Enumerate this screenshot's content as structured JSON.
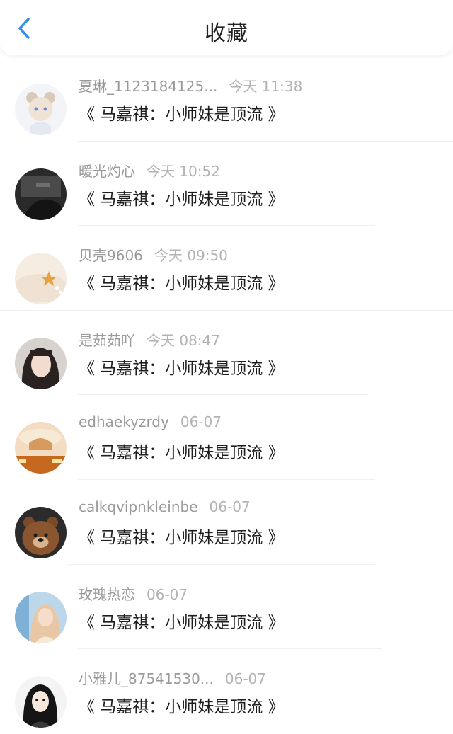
{
  "header": {
    "title": "收藏",
    "back_icon": "chevron-left-icon",
    "accent_color": "#2f8fe8"
  },
  "favorites": [
    {
      "user": "夏琳_1123184125...",
      "time": "今天 11:38",
      "book": "《 马嘉祺：小师妹是顶流 》"
    },
    {
      "user": "暖光灼心",
      "time": "今天 10:52",
      "book": "《 马嘉祺：小师妹是顶流 》"
    },
    {
      "user": "贝壳9606",
      "time": "今天 09:50",
      "book": "《 马嘉祺：小师妹是顶流 》"
    },
    {
      "user": "是茹茹吖",
      "time": "今天 08:47",
      "book": "《 马嘉祺：小师妹是顶流 》"
    },
    {
      "user": "edhaekyzrdy",
      "time": "06-07",
      "book": "《 马嘉祺：小师妹是顶流 》"
    },
    {
      "user": "calkqvipnkleinbe",
      "time": "06-07",
      "book": "《 马嘉祺：小师妹是顶流 》"
    },
    {
      "user": "玫瑰热恋",
      "time": "06-07",
      "book": "《 马嘉祺：小师妹是顶流 》"
    },
    {
      "user": "小雅儿_87541530...",
      "time": "06-07",
      "book": "《 马嘉祺：小师妹是顶流 》"
    }
  ]
}
